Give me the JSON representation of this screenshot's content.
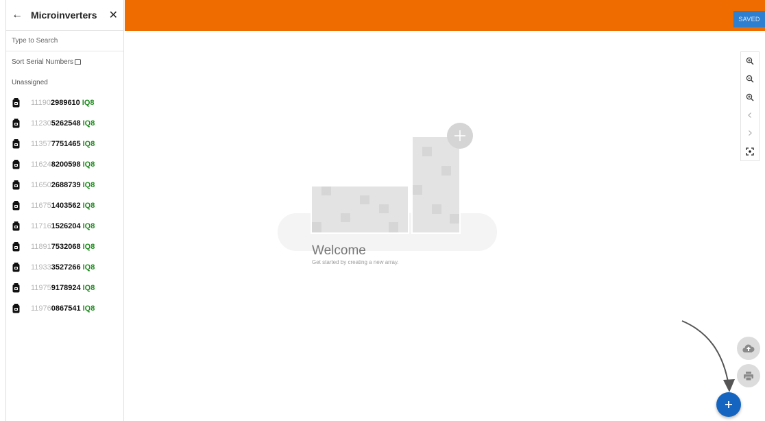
{
  "sidebar": {
    "title": "Microinverters",
    "back_icon": "arrow-left-icon",
    "close_icon": "close-icon",
    "search_placeholder": "Type to Search",
    "sort_label": "Sort Serial Numbers",
    "section_label": "Unassigned",
    "items": [
      {
        "prefix": "11190",
        "serial": "2989610",
        "model": "IQ8"
      },
      {
        "prefix": "11230",
        "serial": "5262548",
        "model": "IQ8"
      },
      {
        "prefix": "11357",
        "serial": "7751465",
        "model": "IQ8"
      },
      {
        "prefix": "11624",
        "serial": "8200598",
        "model": "IQ8"
      },
      {
        "prefix": "11650",
        "serial": "2688739",
        "model": "IQ8"
      },
      {
        "prefix": "11675",
        "serial": "1403562",
        "model": "IQ8"
      },
      {
        "prefix": "11716",
        "serial": "1526204",
        "model": "IQ8"
      },
      {
        "prefix": "11891",
        "serial": "7532068",
        "model": "IQ8"
      },
      {
        "prefix": "11933",
        "serial": "3527266",
        "model": "IQ8"
      },
      {
        "prefix": "11975",
        "serial": "9178924",
        "model": "IQ8"
      },
      {
        "prefix": "11976",
        "serial": "0867541",
        "model": "IQ8"
      }
    ]
  },
  "topbar": {
    "saved_label": "SAVED",
    "color": "#ee6c00"
  },
  "toolbar": {
    "buttons": [
      "zoom-in-icon",
      "zoom-out-icon",
      "zoom-fit-icon",
      "chevron-left-icon",
      "chevron-right-icon",
      "center-focus-icon"
    ]
  },
  "canvas": {
    "welcome_title": "Welcome",
    "welcome_subtitle": "Get started by creating a new array."
  },
  "fabs": {
    "upload_icon": "cloud-upload-icon",
    "print_icon": "print-icon",
    "add_icon": "plus-icon",
    "add_color": "#1565c0"
  }
}
